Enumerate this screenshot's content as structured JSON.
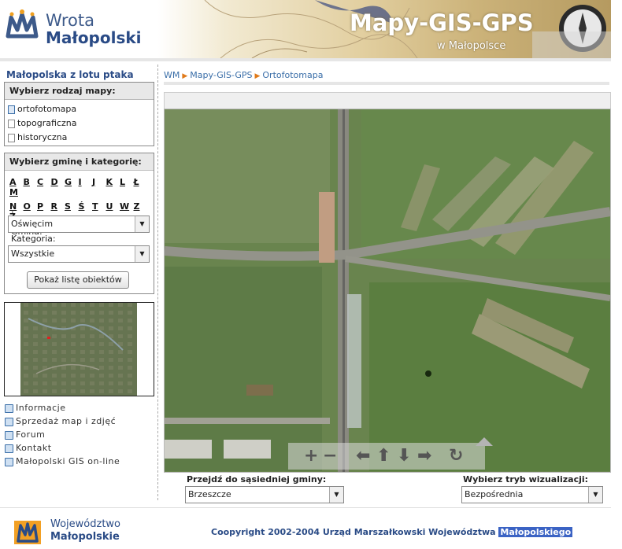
{
  "header": {
    "logo_line1": "Wrota",
    "logo_line2": "Małopolski",
    "banner_title": "Mapy-GIS-GPS",
    "banner_subtitle": "w Małopolsce"
  },
  "sidebar": {
    "title": "Małopolska z lotu ptaka",
    "map_type": {
      "heading": "Wybierz rodzaj mapy:",
      "items": [
        "ortofotomapa",
        "topograficzna",
        "historyczna"
      ]
    },
    "filter": {
      "heading": "Wybierz gminę i kategorię:",
      "letters_row1": [
        "A",
        "B",
        "C",
        "D",
        "G",
        "I",
        "J",
        "K",
        "L",
        "Ł",
        "M"
      ],
      "letters_row2": [
        "N",
        "O",
        "P",
        "R",
        "S",
        "Ś",
        "T",
        "U",
        "W",
        "Z",
        "Ż"
      ],
      "gmina_label": "Gmina:",
      "gmina_value": "Oświęcim",
      "kategoria_label": "Kategoria:",
      "kategoria_value": "Wszystkie",
      "show_button": "Pokaż listę obiektów"
    },
    "links": [
      "Informacje",
      "Sprzedaż map i zdjęć",
      "Forum",
      "Kontakt",
      "Małopolski GIS on-line"
    ]
  },
  "breadcrumb": [
    "WM",
    "Mapy-GIS-GPS",
    "Ortofotomapa"
  ],
  "map_controls": {
    "zoom_in": "+",
    "zoom_out": "−",
    "pan_left": "⬅",
    "pan_up": "⬆",
    "pan_down": "⬇",
    "pan_right": "➡",
    "reset": "↻"
  },
  "bottom": {
    "neighbor_label": "Przejdź do sąsiedniej gminy:",
    "neighbor_value": "Brzeszcze",
    "mode_label": "Wybierz tryb wizualizacji:",
    "mode_value": "Bezpośrednia"
  },
  "footer": {
    "logo_line1": "Województwo",
    "logo_line2": "Małopolskie",
    "copyright_prefix": "Coopyright 2002-2004 Urząd Marszałkowski Województwa",
    "copyright_highlight": "Małopolskiego"
  },
  "colors": {
    "brand_blue": "#2a4b86",
    "link_blue": "#3a6ea8",
    "accent_orange": "#e07a1a",
    "selection": "#3b63c4"
  }
}
